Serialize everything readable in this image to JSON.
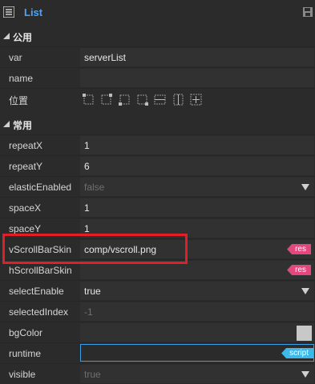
{
  "header": {
    "title": "List",
    "list_icon": "list-icon",
    "save_icon": "save-icon"
  },
  "sections": {
    "public": "公用",
    "common": "常用"
  },
  "public_rows": [
    {
      "name": "var",
      "value": "serverList"
    },
    {
      "name": "name",
      "value": ""
    },
    {
      "name": "位置"
    }
  ],
  "common_rows": [
    {
      "name": "repeatX",
      "value": "1"
    },
    {
      "name": "repeatY",
      "value": "6"
    },
    {
      "name": "elasticEnabled",
      "value": "false"
    },
    {
      "name": "spaceX",
      "value": "1"
    },
    {
      "name": "spaceY",
      "value": "1"
    },
    {
      "name": "vScrollBarSkin",
      "value": "comp/vscroll.png",
      "tag": "res"
    },
    {
      "name": "hScrollBarSkin",
      "value": "",
      "tag": "res"
    },
    {
      "name": "selectEnable",
      "value": "true"
    },
    {
      "name": "selectedIndex",
      "value": "-1"
    },
    {
      "name": "bgColor",
      "value": ""
    },
    {
      "name": "runtime",
      "value": "",
      "tag": "script"
    },
    {
      "name": "visible",
      "value": "true"
    }
  ],
  "colors": {
    "accent": "#4aa3ff",
    "res_tag": "#e4477e",
    "script_tag": "#3db8e8",
    "highlight": "#e21f26"
  }
}
